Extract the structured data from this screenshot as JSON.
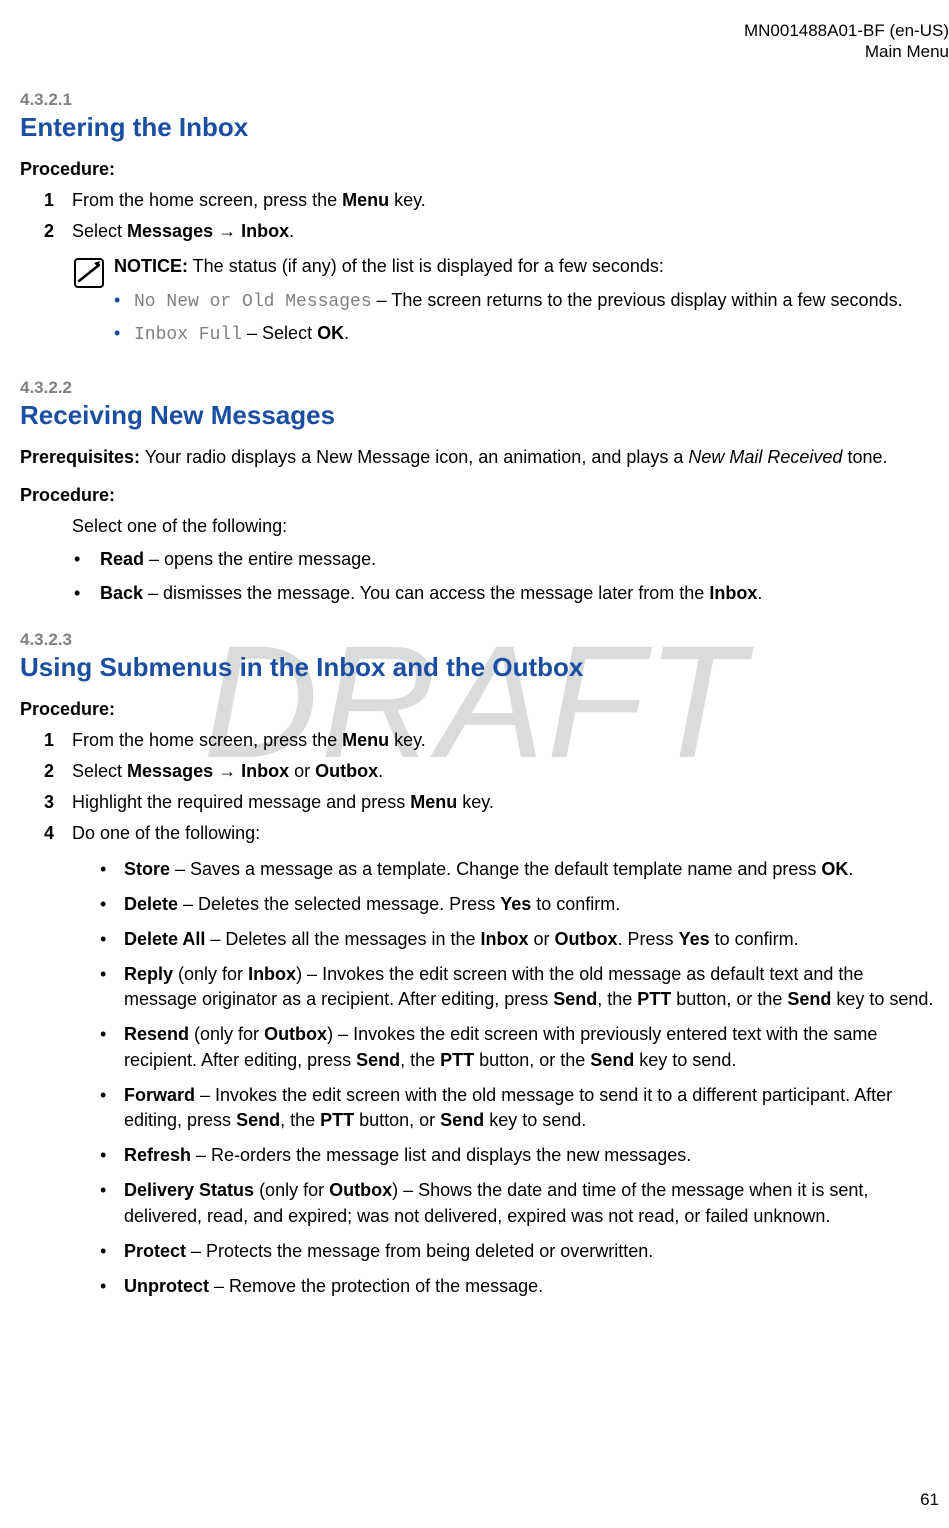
{
  "header": {
    "doc_id": "MN001488A01-BF (en-US)",
    "section": "Main Menu"
  },
  "watermark": "DRAFT",
  "page_number": "61",
  "s1": {
    "num": "4.3.2.1",
    "title": "Entering the Inbox",
    "procedure_label": "Procedure:",
    "step1_a": "From the home screen, press the ",
    "step1_b": "Menu",
    "step1_c": " key.",
    "step2_a": "Select ",
    "step2_b": "Messages → Inbox",
    "step2_c": ".",
    "notice_label": "NOTICE:",
    "notice_text": " The status (if any) of the list is displayed for a few seconds:",
    "n1_code": "No New or Old Messages",
    "n1_rest": " – The screen returns to the previous display within a few seconds.",
    "n2_code": "Inbox Full",
    "n2_a": " – Select ",
    "n2_b": "OK",
    "n2_c": "."
  },
  "s2": {
    "num": "4.3.2.2",
    "title": "Receiving New Messages",
    "prereq_label": "Prerequisites:",
    "prereq_a": " Your radio displays a New Message icon, an animation, and plays a ",
    "prereq_i": "New Mail Received",
    "prereq_b": " tone.",
    "procedure_label": "Procedure:",
    "intro": "Select one of the following:",
    "b1_b": "Read",
    "b1_t": " – opens the entire message.",
    "b2_b": "Back",
    "b2_a": " – dismisses the message. You can access the message later from the ",
    "b2_c": "Inbox",
    "b2_d": "."
  },
  "s3": {
    "num": "4.3.2.3",
    "title": "Using Submenus in the Inbox and the Outbox",
    "procedure_label": "Procedure:",
    "step1_a": "From the home screen, press the ",
    "step1_b": "Menu",
    "step1_c": " key.",
    "step2_a": "Select ",
    "step2_b": "Messages → Inbox",
    "step2_c": " or ",
    "step2_d": "Outbox",
    "step2_e": ".",
    "step3_a": "Highlight the required message and press ",
    "step3_b": "Menu",
    "step3_c": " key.",
    "step4": "Do one of the following:",
    "i1_b": "Store",
    "i1_t1": " – Saves a message as a template. Change the default template name and press ",
    "i1_t2": "OK",
    "i1_t3": ".",
    "i2_b": "Delete",
    "i2_t1": " – Deletes the selected message. Press ",
    "i2_t2": "Yes",
    "i2_t3": " to confirm.",
    "i3_b": "Delete All",
    "i3_t1": " – Deletes all the messages in the ",
    "i3_t2": "Inbox",
    "i3_t3": " or ",
    "i3_t4": "Outbox",
    "i3_t5": ". Press ",
    "i3_t6": "Yes",
    "i3_t7": " to confirm.",
    "i4_b": "Reply",
    "i4_t1": " (only for ",
    "i4_t2": "Inbox",
    "i4_t3": ") – Invokes the edit screen with the old message as default text and the message originator as a recipient. After editing, press ",
    "i4_t4": "Send",
    "i4_t5": ", the ",
    "i4_t6": "PTT",
    "i4_t7": " button, or the ",
    "i4_t8": "Send",
    "i4_t9": " key to send.",
    "i5_b": "Resend",
    "i5_t1": " (only for ",
    "i5_t2": "Outbox",
    "i5_t3": ") – Invokes the edit screen with previously entered text with the same recipient. After editing, press ",
    "i5_t4": "Send",
    "i5_t5": ", the ",
    "i5_t6": "PTT",
    "i5_t7": " button, or the ",
    "i5_t8": "Send",
    "i5_t9": " key to send.",
    "i6_b": "Forward",
    "i6_t1": " – Invokes the edit screen with the old message to send it to a different participant. After editing, press ",
    "i6_t2": "Send",
    "i6_t3": ", the ",
    "i6_t4": "PTT",
    "i6_t5": " button, or ",
    "i6_t6": "Send",
    "i6_t7": " key to send.",
    "i7_b": "Refresh",
    "i7_t": " – Re-orders the message list and displays the new messages.",
    "i8_b": "Delivery Status",
    "i8_t1": " (only for ",
    "i8_t2": "Outbox",
    "i8_t3": ") – Shows the date and time of the message when it is sent, delivered, read, and expired; was not delivered, expired was not read, or failed unknown.",
    "i9_b": "Protect",
    "i9_t": " – Protects the message from being deleted or overwritten.",
    "i10_b": "Unprotect",
    "i10_t": " – Remove the protection of the message."
  }
}
